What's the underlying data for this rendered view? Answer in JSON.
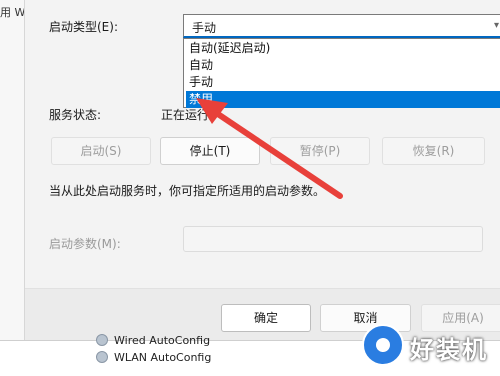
{
  "background": {
    "left_fragment": "用 W",
    "services_below": [
      "Wired AutoConfig",
      "WLAN AutoConfig"
    ]
  },
  "dialog": {
    "startup_type": {
      "label": "启动类型(E):",
      "current_value": "手动",
      "options": [
        "自动(延迟启动)",
        "自动",
        "手动",
        "禁用"
      ],
      "highlighted_option": "禁用"
    },
    "service_status": {
      "label": "服务状态:",
      "value": "正在运行"
    },
    "buttons": {
      "start": "启动(S)",
      "stop": "停止(T)",
      "pause": "暂停(P)",
      "resume": "恢复(R)"
    },
    "hint": "当从此处启动服务时，你可指定所适用的启动参数。",
    "start_params": {
      "label": "启动参数(M):",
      "value": ""
    },
    "footer": {
      "ok": "确定",
      "cancel": "取消",
      "apply": "应用(A)"
    }
  },
  "colors": {
    "accent": "#0078d7",
    "arrow": "#e8403a"
  },
  "watermark": {
    "text": "好装机"
  }
}
